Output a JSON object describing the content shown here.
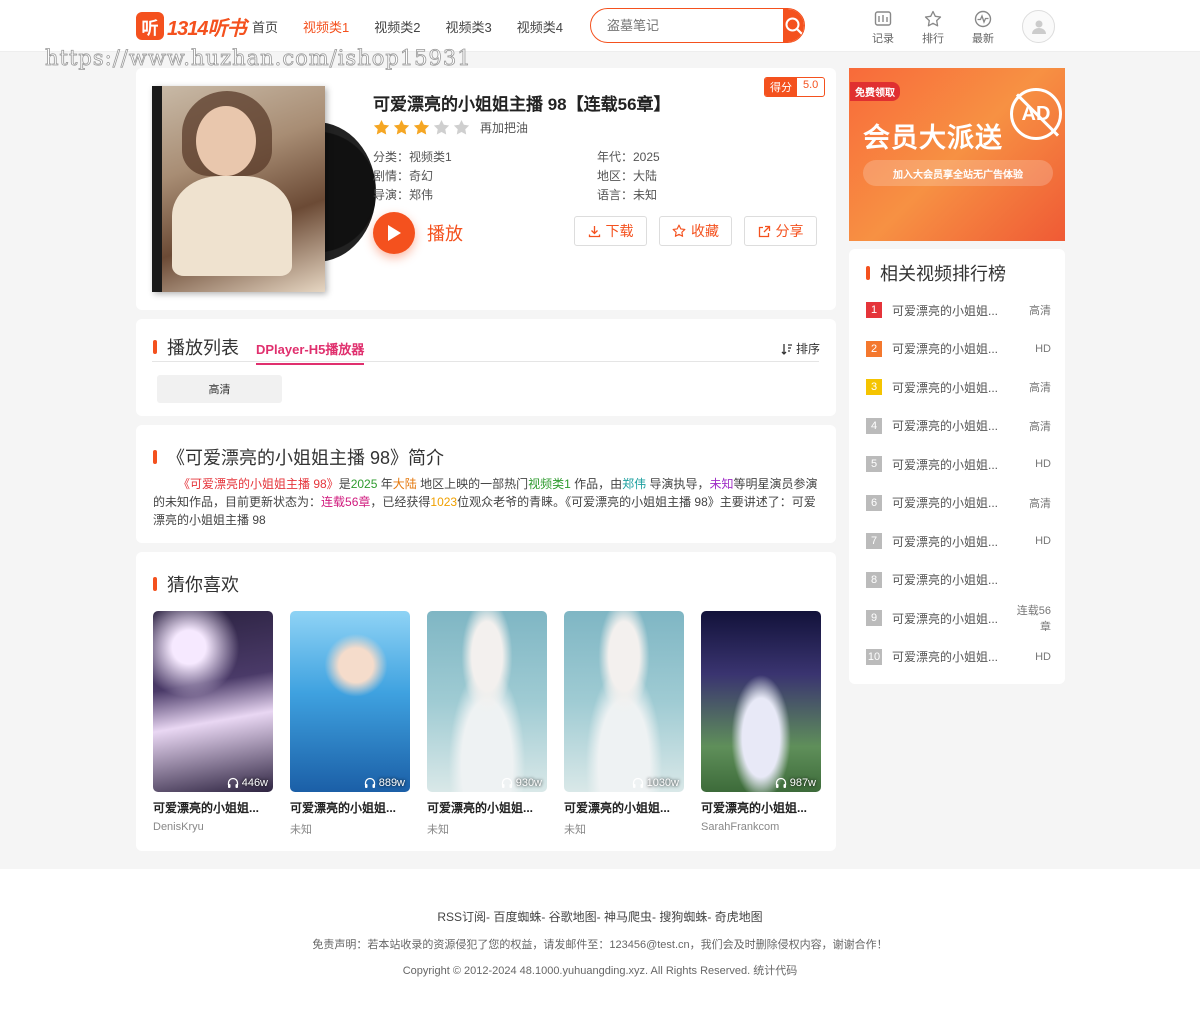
{
  "header": {
    "logo_mark": "听",
    "logo_text": "1314听书",
    "nav": [
      "首页",
      "视频类1",
      "视频类2",
      "视频类3",
      "视频类4"
    ],
    "active_nav": "视频类1",
    "search_placeholder": "盗墓笔记",
    "icons": [
      {
        "label": "记录",
        "icon": "history-icon"
      },
      {
        "label": "排行",
        "icon": "star-icon"
      },
      {
        "label": "最新",
        "icon": "pulse-icon"
      }
    ]
  },
  "watermark": "https://www.huzhan.com/ishop15931",
  "detail": {
    "title": "可爱漂亮的小姐姐主播 98【连载56章】",
    "score_label": "得分",
    "score_value": "5.0",
    "rating_stars": 3,
    "rating_max": 5,
    "rating_tip": "再加把油",
    "category": "分类：视频类1",
    "plot": "剧情：奇幻",
    "director": "导演：郑伟",
    "year": "年代：2025",
    "region": "地区：大陆",
    "language": "语言：未知",
    "play_label": "播放",
    "download_label": "下载",
    "favorite_label": "收藏",
    "share_label": "分享"
  },
  "playlist": {
    "title": "播放列表",
    "tab": "DPlayer-H5播放器",
    "sort_label": "排序",
    "episodes": [
      "高清"
    ]
  },
  "intro": {
    "title": "《可爱漂亮的小姐姐主播 98》简介",
    "p1": "《可爱漂亮的小姐姐主播 98》",
    "p2": "是",
    "p3": "2025",
    "p4": " 年",
    "p5": "大陆",
    "p6": " 地区上映的一部热门",
    "p7": "视频类1",
    "p8": " 作品，由",
    "p9": "郑伟",
    "p10": " 导演执导，",
    "p11": "未知",
    "p12": "等明星演员参演的未知作品，目前更新状态为：",
    "p13": "连载56章",
    "p14": "，已经获得",
    "p15": "1023",
    "p16": "位观众老爷的青睐。《可爱漂亮的小姐姐主播 98》主要讲述了：可爱漂亮的小姐姐主播 98"
  },
  "guess": {
    "title": "猜你喜欢",
    "items": [
      {
        "title": "可爱漂亮的小姐姐...",
        "author": "DenisKryu",
        "count": "446w"
      },
      {
        "title": "可爱漂亮的小姐姐...",
        "author": "未知",
        "count": "889w"
      },
      {
        "title": "可爱漂亮的小姐姐...",
        "author": "未知",
        "count": "930w"
      },
      {
        "title": "可爱漂亮的小姐姐...",
        "author": "未知",
        "count": "1030w"
      },
      {
        "title": "可爱漂亮的小姐姐...",
        "author": "SarahFrankcom",
        "count": "987w"
      }
    ]
  },
  "ad": {
    "tag": "免费领取",
    "title": "会员大派送",
    "subtitle": "加入大会员享全站无广告体验",
    "badge": "AD"
  },
  "rank": {
    "title": "相关视频排行榜",
    "items": [
      {
        "num": "1",
        "name": "可爱漂亮的小姐姐...",
        "tag": "高清",
        "color": "#e5343a"
      },
      {
        "num": "2",
        "name": "可爱漂亮的小姐姐...",
        "tag": "HD",
        "color": "#f4782e"
      },
      {
        "num": "3",
        "name": "可爱漂亮的小姐姐...",
        "tag": "高清",
        "color": "#f5c400"
      },
      {
        "num": "4",
        "name": "可爱漂亮的小姐姐...",
        "tag": "高清",
        "color": "#bbbbbb"
      },
      {
        "num": "5",
        "name": "可爱漂亮的小姐姐...",
        "tag": "HD",
        "color": "#bbbbbb"
      },
      {
        "num": "6",
        "name": "可爱漂亮的小姐姐...",
        "tag": "高清",
        "color": "#bbbbbb"
      },
      {
        "num": "7",
        "name": "可爱漂亮的小姐姐...",
        "tag": "HD",
        "color": "#bbbbbb"
      },
      {
        "num": "8",
        "name": "可爱漂亮的小姐姐...",
        "tag": "",
        "color": "#bbbbbb"
      },
      {
        "num": "9",
        "name": "可爱漂亮的小姐姐...",
        "tag": "连载56章",
        "color": "#bbbbbb"
      },
      {
        "num": "10",
        "name": "可爱漂亮的小姐姐...",
        "tag": "HD",
        "color": "#bbbbbb"
      }
    ]
  },
  "footer": {
    "links": "RSS订阅- 百度蜘蛛- 谷歌地图- 神马爬虫- 搜狗蜘蛛- 奇虎地图",
    "claim": "免责声明：若本站收录的资源侵犯了您的权益，请发邮件至：123456@test.cn，我们会及时删除侵权内容，谢谢合作！",
    "copyright": "Copyright © 2012-2024 48.1000.yuhuangding.xyz. All Rights Reserved. 统计代码"
  },
  "colors": {
    "accent": "#f4511e",
    "tab_pink": "#e0306e"
  }
}
